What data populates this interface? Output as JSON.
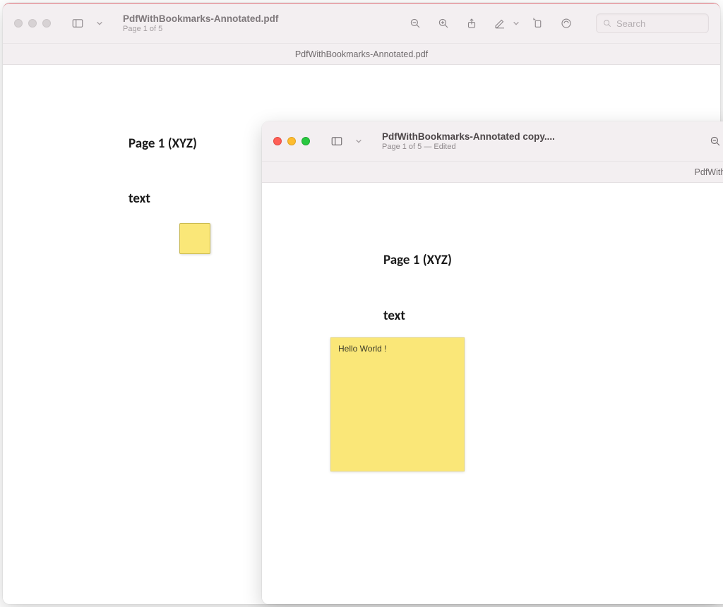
{
  "back_window": {
    "title": "PdfWithBookmarks-Annotated.pdf",
    "subtitle": "Page 1 of 5",
    "doc_label": "PdfWithBookmarks-Annotated.pdf",
    "search_placeholder": "Search",
    "content": {
      "heading": "Page 1 (XYZ)",
      "subheading": "text"
    }
  },
  "front_window": {
    "title": "PdfWithBookmarks-Annotated copy....",
    "subtitle": "Page 1 of 5 — Edited",
    "doc_label": "PdfWithBookmarks-Annotated",
    "content": {
      "heading": "Page 1 (XYZ)",
      "subheading": "text",
      "note_text": "Hello World !"
    }
  }
}
